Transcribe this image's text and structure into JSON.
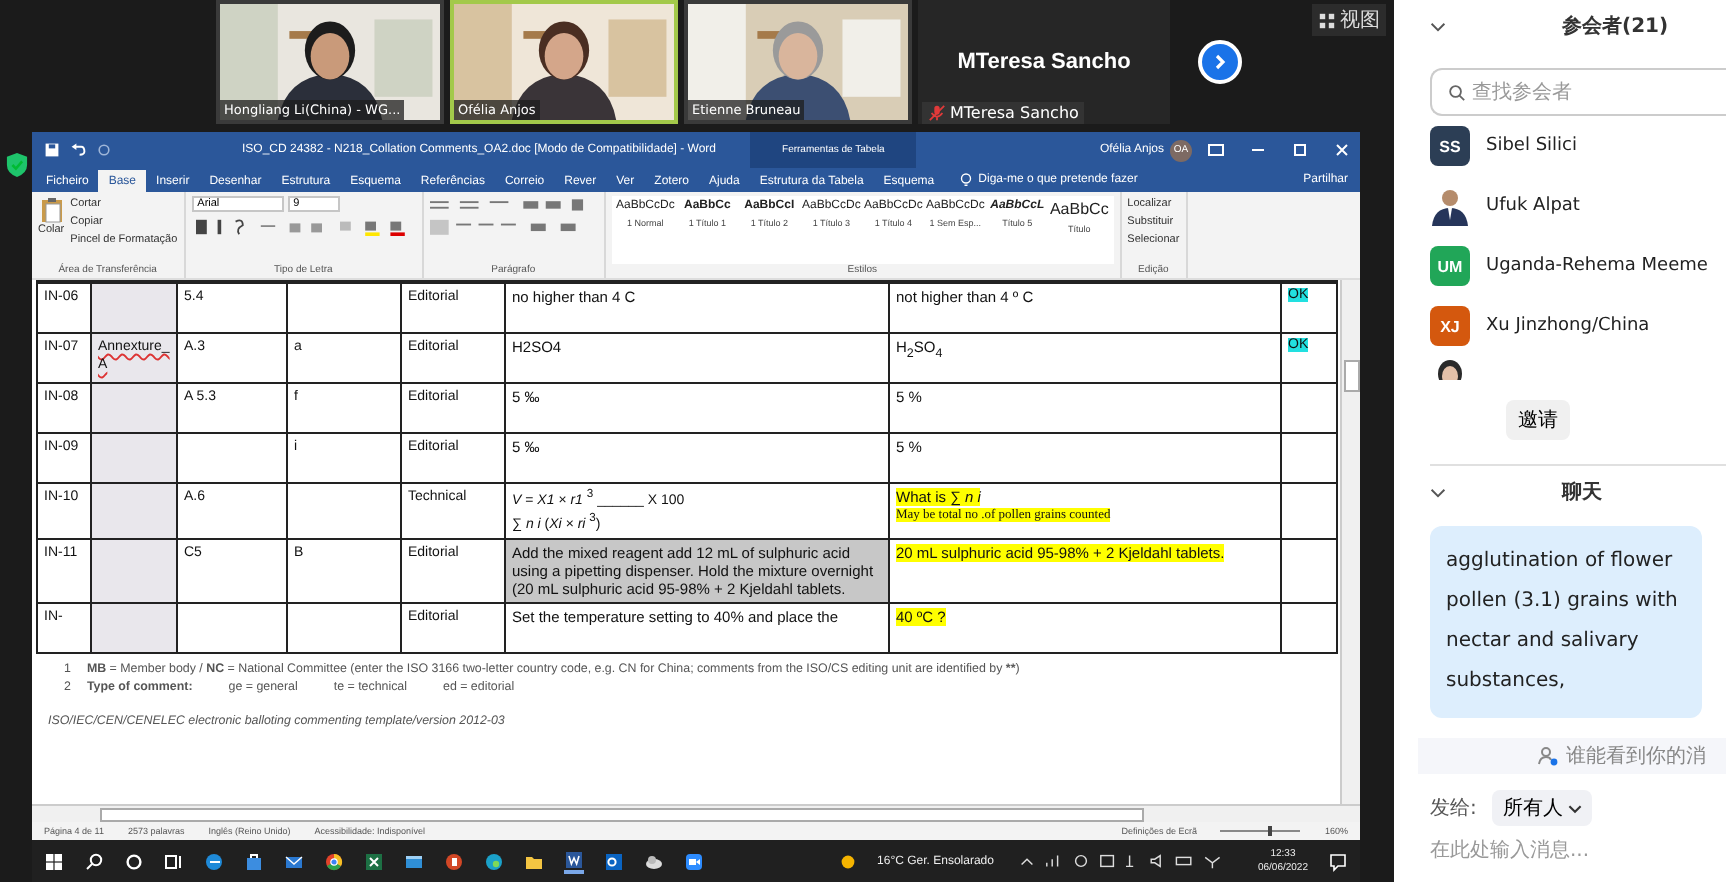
{
  "meeting": {
    "view_label": "视图",
    "tiles": [
      {
        "kind": "video",
        "name": "Hongliang Li(China) - WG...",
        "active": false
      },
      {
        "kind": "video",
        "name": "Ofélia Anjos",
        "active": true
      },
      {
        "kind": "video",
        "name": "Etienne Bruneau",
        "active": false
      },
      {
        "kind": "name",
        "display": "MTeresa Sancho",
        "name": "MTeresa Sancho",
        "muted": true
      }
    ]
  },
  "word": {
    "title": "ISO_CD 24382 - N218_Collation Comments_OA2.doc [Modo de Compatibilidade] - Word",
    "table_tools": "Ferramentas de Tabela",
    "user": "Ofélia Anjos",
    "user_initials": "OA",
    "tabs": [
      {
        "label": "Ficheiro",
        "selected": false
      },
      {
        "label": "Base",
        "selected": true
      },
      {
        "label": "Inserir",
        "selected": false
      },
      {
        "label": "Desenhar",
        "selected": false
      },
      {
        "label": "Estrutura",
        "selected": false
      },
      {
        "label": "Esquema",
        "selected": false
      },
      {
        "label": "Referências",
        "selected": false
      },
      {
        "label": "Correio",
        "selected": false
      },
      {
        "label": "Rever",
        "selected": false
      },
      {
        "label": "Ver",
        "selected": false
      },
      {
        "label": "Zotero",
        "selected": false
      },
      {
        "label": "Ajuda",
        "selected": false
      },
      {
        "label": "Estrutura da Tabela",
        "selected": false
      },
      {
        "label": "Esquema",
        "selected": false
      }
    ],
    "tell_me": "Diga-me o que pretende fazer",
    "share": "Partilhar",
    "clipboard": {
      "paste": "Colar",
      "items": [
        "Cortar",
        "Copiar",
        "Pincel de Formatação"
      ],
      "group": "Área de Transferência"
    },
    "font": {
      "name": "Arial",
      "size": "9",
      "group": "Tipo de Letra"
    },
    "paragraph": {
      "group": "Parágrafo"
    },
    "styles": {
      "items": [
        {
          "sample": "AaBbCcDc",
          "name": "1 Normal",
          "kind": "plain"
        },
        {
          "sample": "AaBbCc",
          "name": "1 Título 1",
          "kind": "bold"
        },
        {
          "sample": "AaBbCcI",
          "name": "1 Título 2",
          "kind": "bold"
        },
        {
          "sample": "AaBbCcDc",
          "name": "1 Título 3",
          "kind": "plain"
        },
        {
          "sample": "AaBbCcDc",
          "name": "1 Título 4",
          "kind": "plain"
        },
        {
          "sample": "AaBbCcDc",
          "name": "1 Sem Esp...",
          "kind": "plain"
        },
        {
          "sample": "AaBbCcL",
          "name": "Título 5",
          "kind": "bolditalic"
        },
        {
          "sample": "AaBbCc",
          "name": "Título",
          "kind": "large"
        }
      ],
      "group": "Estilos"
    },
    "editing": {
      "items": [
        "Localizar",
        "Substituir",
        "Selecionar"
      ],
      "group": "Edição"
    },
    "table": {
      "rows": [
        {
          "cells": [
            "IN-06",
            "",
            "5.4",
            "",
            "Editorial"
          ],
          "comment": [
            "no higher than 4 C"
          ],
          "comment_selected": false,
          "change": [
            "not higher than 4 º C"
          ],
          "change_highlight": false,
          "observation": "OK"
        },
        {
          "cells": [
            "IN-07",
            "Annexture_A",
            "A.3",
            "a",
            "Editorial"
          ],
          "comment": [
            "H2SO4"
          ],
          "comment_selected": false,
          "change": [
            "H$_{2}$SO$_{4}$"
          ],
          "change_highlight": false,
          "observation": "OK"
        },
        {
          "cells": [
            "IN-08",
            "",
            "A 5.3",
            "f",
            "Editorial"
          ],
          "comment": [
            " 5 ‰"
          ],
          "comment_selected": false,
          "change": [
            " 5 %"
          ],
          "change_highlight": false
        },
        {
          "cells": [
            "IN-09",
            "",
            "",
            "i",
            "Editorial"
          ],
          "comment": [
            " 5 ‰"
          ],
          "comment_selected": false,
          "change": [
            " 5 %"
          ],
          "change_highlight": false
        },
        {
          "cells": [
            "IN-10",
            "",
            "A.6",
            "",
            "Technical"
          ],
          "comment": [
            "*V* = *X1 × r1* $^{3}$ ______ X 100",
            "∑ *n i* (*Xi × ri* $^{3}$)"
          ],
          "comment_selected": false,
          "change": [
            "What is  ∑  *n i*",
            "May be total no .of pollen grains counted"
          ],
          "change_highlight": true
        },
        {
          "cells": [
            "IN-11",
            "",
            "C5",
            "B",
            "Editorial"
          ],
          "comment": [
            "Add the mixed reagent add 12 mL of sulphuric acid using a pipetting dispenser. Hold the mixture overnight (20 mL sulphuric acid 95-98% + 2 Kjeldahl tablets."
          ],
          "comment_selected": true,
          "change": [
            "20 mL sulphuric acid 95-98% + 2 Kjeldahl tablets."
          ],
          "change_highlight": true
        },
        {
          "cells": [
            "IN-",
            "",
            "",
            "",
            "Editorial"
          ],
          "comment": [
            "Set the temperature setting to 40% and place the"
          ],
          "comment_selected": false,
          "change": [
            "40 ºC ?"
          ],
          "change_highlight": true
        }
      ]
    },
    "footnotes": [
      {
        "number": "1",
        "segments": [
          {
            "text": "MB",
            "bold": true
          },
          {
            "text": " = Member body / ",
            "bold": false
          },
          {
            "text": "NC",
            "bold": true
          },
          {
            "text": " = National Committee (enter the ISO 3166 two-letter country code, e.g. CN for China; comments from the ISO/CS editing unit are identified by ",
            "bold": false
          },
          {
            "text": "**",
            "bold": true
          },
          {
            "text": ")",
            "bold": false
          }
        ]
      }
    ],
    "comment_types": {
      "number": "2",
      "label": "Type of comment:",
      "items": [
        "ge = general",
        "te = technical",
        "ed = editorial"
      ]
    },
    "template_note": "ISO/IEC/CEN/CENELEC  electronic balloting commenting template/version 2012-03",
    "status": {
      "page": "Página 4 de 11",
      "words": "2573 palavras",
      "language": "Inglês (Reino Unido)",
      "accessibility": "Acessibilidade: Indisponível",
      "display": "Definições de Ecrã",
      "zoom": "160%",
      "zoom_level": {
        "level": 0.6
      }
    }
  },
  "taskbar": {
    "weather": "16°C  Ger. Ensolarado",
    "time": "12:33",
    "date": "06/06/2022"
  },
  "participants": {
    "title": "参会者(21)",
    "search_placeholder": "查找参会者",
    "people": [
      {
        "kind": "initials",
        "initials": "SS",
        "name": "Sibel Silici",
        "color": "#2c3e55"
      },
      {
        "name": "Ufuk Alpat"
      },
      {
        "kind": "initials",
        "initials": "UM",
        "name": "Uganda-Rehema Meeme",
        "color": "#21a658"
      },
      {
        "kind": "initials",
        "initials": "XJ",
        "name": "Xu Jinzhong/China",
        "color": "#d4580e"
      }
    ],
    "invite": "邀请"
  },
  "chat": {
    "title": "聊天",
    "message": "agglutination of flower pollen (3.1) grains with nectar and salivary substances,",
    "visibility": "谁能看到你的消",
    "send_to_label": "发给:",
    "recipient": "所有人",
    "placeholder": "在此处输入消息..."
  }
}
